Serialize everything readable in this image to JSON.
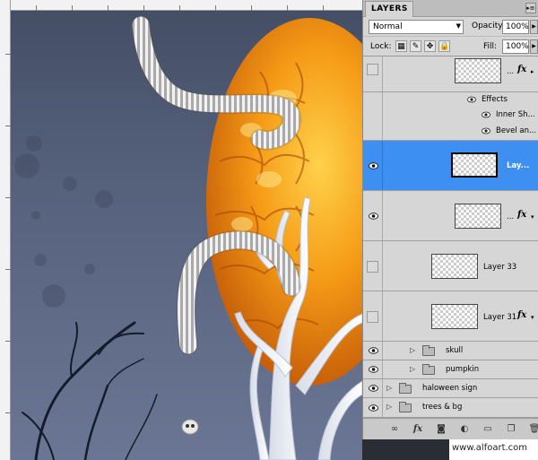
{
  "panel": {
    "tab_label": "LAYERS",
    "menu_icon": "panel-menu-icon",
    "blend_mode": "Normal",
    "opacity_label": "Opacity:",
    "opacity_value": "100%",
    "lock_label": "Lock:",
    "fill_label": "Fill:",
    "fill_value": "100%"
  },
  "layers": [
    {
      "name": "...",
      "visible": false,
      "has_fx": true
    },
    {
      "name": "Effects",
      "type": "effects-header"
    },
    {
      "name": "Inner Sh...",
      "type": "effect"
    },
    {
      "name": "Bevel an...",
      "type": "effect"
    },
    {
      "name": "Lay...",
      "visible": true,
      "selected": true
    },
    {
      "name": "...",
      "visible": true,
      "has_fx": true
    },
    {
      "name": "Layer 33",
      "visible": false
    },
    {
      "name": "Layer 31",
      "visible": false,
      "has_fx": true
    },
    {
      "name": "skull",
      "visible": true,
      "type": "group"
    },
    {
      "name": "pumpkin",
      "visible": true,
      "type": "group"
    },
    {
      "name": "haloween sign",
      "visible": true,
      "type": "group"
    },
    {
      "name": "trees & bg",
      "visible": true,
      "type": "group"
    }
  ],
  "footer": {
    "icons": [
      "link-icon",
      "fx-icon",
      "mask-icon",
      "adjustment-icon",
      "group-icon",
      "new-layer-icon",
      "trash-icon"
    ]
  },
  "watermark": "www.alfoart.com",
  "colors": {
    "selection": "#3d8ff2",
    "panel_bg": "#d6d6d6",
    "pumpkin": "#f08a10"
  }
}
